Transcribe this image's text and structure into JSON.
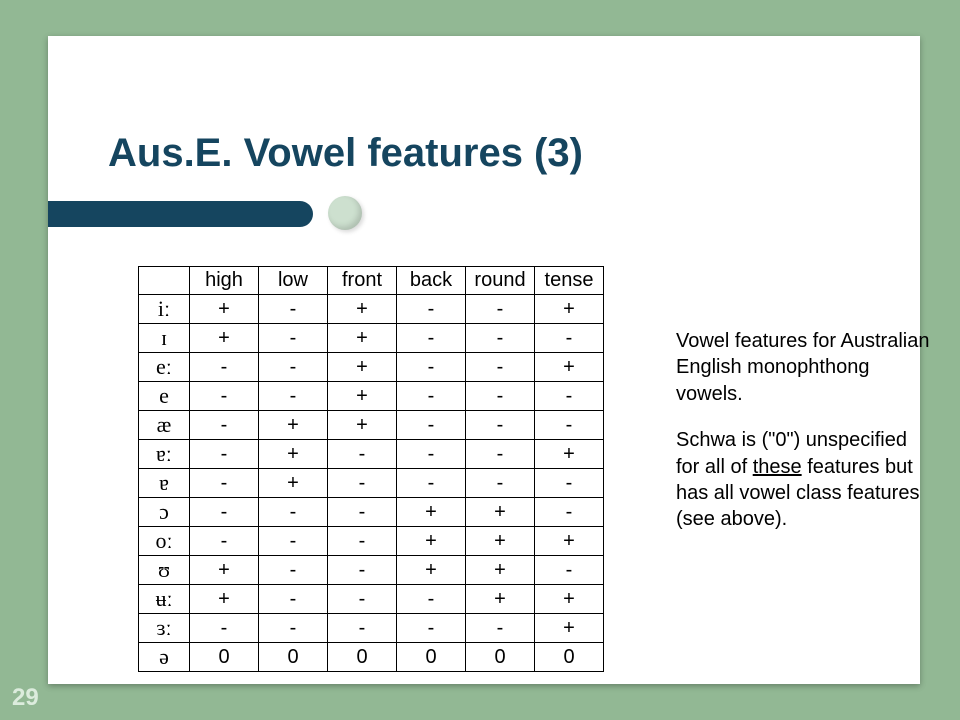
{
  "title": "Aus.E. Vowel features (3)",
  "page_number": "29",
  "table": {
    "headers": [
      "",
      "high",
      "low",
      "front",
      "back",
      "round",
      "tense"
    ],
    "rows": [
      {
        "vowel": "iː",
        "vals": [
          "+",
          "-",
          "+",
          "-",
          "-",
          "+"
        ]
      },
      {
        "vowel": "ɪ",
        "vals": [
          "+",
          "-",
          "+",
          "-",
          "-",
          "-"
        ]
      },
      {
        "vowel": "eː",
        "vals": [
          "-",
          "-",
          "+",
          "-",
          "-",
          "+"
        ]
      },
      {
        "vowel": "e",
        "vals": [
          "-",
          "-",
          "+",
          "-",
          "-",
          "-"
        ]
      },
      {
        "vowel": "æ",
        "vals": [
          "-",
          "+",
          "+",
          "-",
          "-",
          "-"
        ]
      },
      {
        "vowel": "ɐː",
        "vals": [
          "-",
          "+",
          "-",
          "-",
          "-",
          "+"
        ]
      },
      {
        "vowel": "ɐ",
        "vals": [
          "-",
          "+",
          "-",
          "-",
          "-",
          "-"
        ]
      },
      {
        "vowel": "ɔ",
        "vals": [
          "-",
          "-",
          "-",
          "+",
          "+",
          "-"
        ]
      },
      {
        "vowel": "oː",
        "vals": [
          "-",
          "-",
          "-",
          "+",
          "+",
          "+"
        ]
      },
      {
        "vowel": "ʊ",
        "vals": [
          "+",
          "-",
          "-",
          "+",
          "+",
          "-"
        ]
      },
      {
        "vowel": "ʉː",
        "vals": [
          "+",
          "-",
          "-",
          "-",
          "+",
          "+"
        ]
      },
      {
        "vowel": "ɜː",
        "vals": [
          "-",
          "-",
          "-",
          "-",
          "-",
          "+"
        ]
      },
      {
        "vowel": "ə",
        "vals": [
          "0",
          "0",
          "0",
          "0",
          "0",
          "0"
        ]
      }
    ]
  },
  "sidetext": {
    "p1": "Vowel features for Australian English monophthong vowels.",
    "p2_a": "Schwa is (\"0\") unspecified for all of ",
    "p2_u": "these",
    "p2_b": " features but has all vowel class features (see above)."
  }
}
